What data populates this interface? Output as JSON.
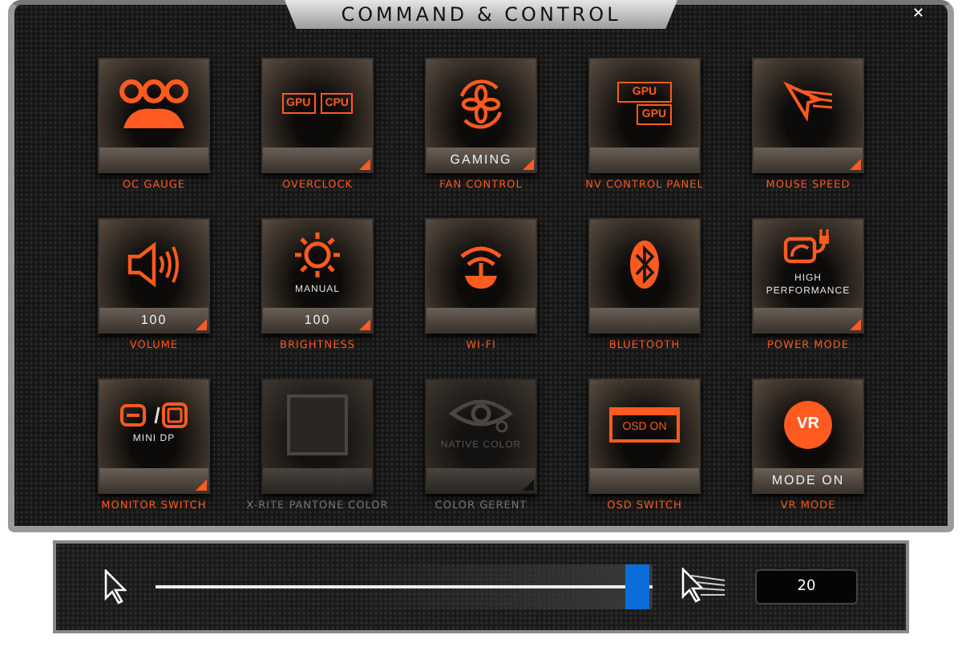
{
  "window": {
    "title": "COMMAND & CONTROL",
    "close": "✕"
  },
  "tiles": [
    {
      "kind": "oc-gauge",
      "label": "OC GAUGE",
      "enabled": true,
      "menu": false
    },
    {
      "kind": "overclock",
      "label": "OVERCLOCK",
      "chips": [
        "GPU",
        "CPU"
      ],
      "enabled": true,
      "menu": true
    },
    {
      "kind": "fan",
      "label": "FAN CONTROL",
      "caption": "GAMING",
      "enabled": true,
      "menu": true
    },
    {
      "kind": "nv",
      "label": "NV CONTROL PANEL",
      "chips": [
        "GPU",
        "GPU"
      ],
      "enabled": true,
      "menu": false
    },
    {
      "kind": "mouse",
      "label": "MOUSE SPEED",
      "enabled": true,
      "menu": true
    },
    {
      "kind": "volume",
      "label": "VOLUME",
      "caption": "100",
      "enabled": true,
      "menu": true
    },
    {
      "kind": "brightness",
      "label": "BRIGHTNESS",
      "status": "MANUAL",
      "caption": "100",
      "enabled": true,
      "menu": true
    },
    {
      "kind": "wifi",
      "label": "WI-FI",
      "enabled": true,
      "menu": false
    },
    {
      "kind": "bluetooth",
      "label": "BLUETOOTH",
      "enabled": true,
      "menu": false
    },
    {
      "kind": "power",
      "label": "POWER MODE",
      "status": "HIGH PERFORMANCE",
      "enabled": true,
      "menu": true
    },
    {
      "kind": "monitor",
      "label": "MONITOR SWITCH",
      "status": "MINI DP",
      "enabled": true,
      "menu": true
    },
    {
      "kind": "xrite",
      "label": "X-RITE PANTONE COLOR",
      "enabled": false,
      "menu": false
    },
    {
      "kind": "eye",
      "label": "COLOR GERENT",
      "status": "NATIVE COLOR",
      "enabled": false,
      "menu": true
    },
    {
      "kind": "osd",
      "label": "OSD SWITCH",
      "chips": [
        "OSD ON"
      ],
      "enabled": true,
      "menu": false
    },
    {
      "kind": "vr",
      "label": "VR MODE",
      "chips": [
        "VR"
      ],
      "caption": "MODE ON",
      "enabled": true,
      "menu": false
    }
  ],
  "slider": {
    "level": 0.97,
    "value": "20"
  }
}
